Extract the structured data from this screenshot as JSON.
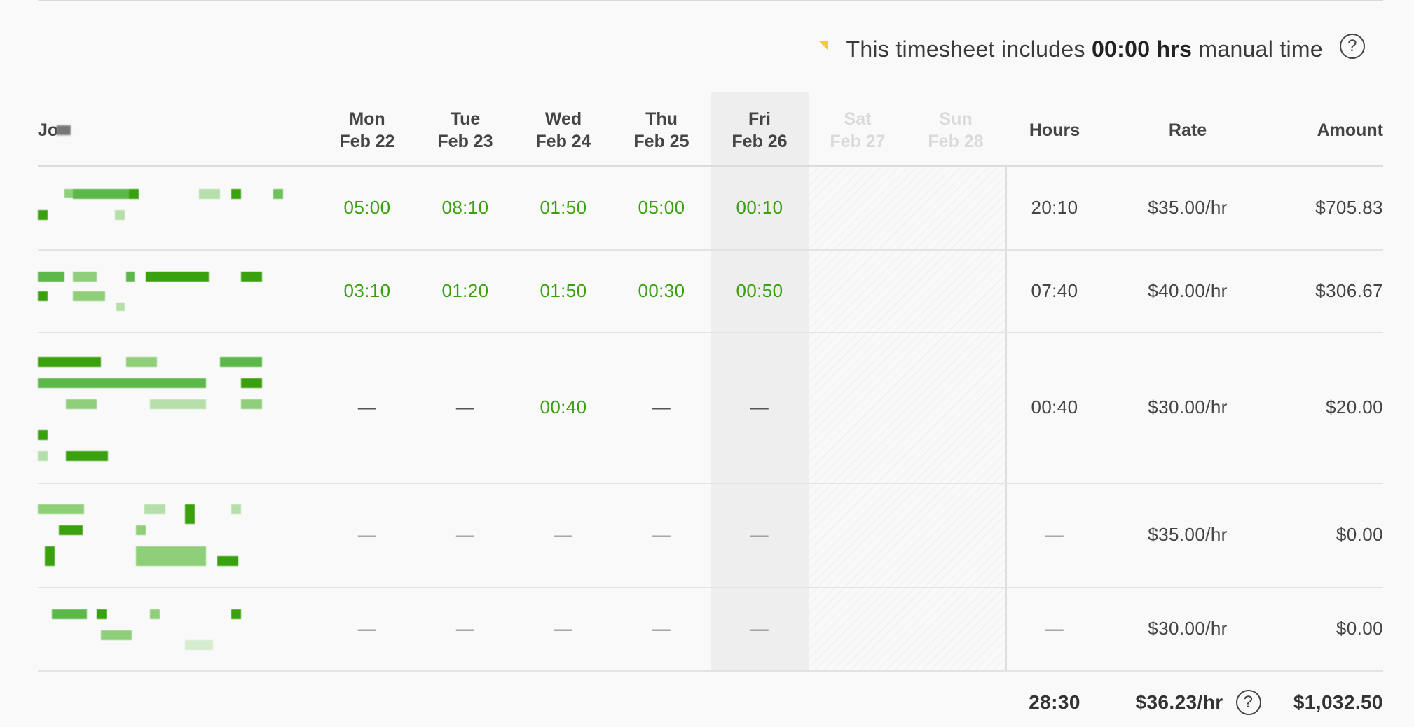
{
  "notice": {
    "prefix": "This timesheet includes",
    "hours": "00:00 hrs",
    "suffix": "manual time",
    "help_glyph": "?",
    "flag_color": "#f5c842"
  },
  "header": {
    "job": "Jo",
    "days": [
      {
        "dow": "Mon",
        "date": "Feb 22"
      },
      {
        "dow": "Tue",
        "date": "Feb 23"
      },
      {
        "dow": "Wed",
        "date": "Feb 24"
      },
      {
        "dow": "Thu",
        "date": "Feb 25"
      },
      {
        "dow": "Fri",
        "date": "Feb 26"
      },
      {
        "dow": "Sat",
        "date": "Feb 27"
      },
      {
        "dow": "Sun",
        "date": "Feb 28"
      }
    ],
    "hours": "Hours",
    "rate": "Rate",
    "amount": "Amount"
  },
  "rows": [
    {
      "days": [
        "05:00",
        "08:10",
        "01:50",
        "05:00",
        "00:10"
      ],
      "hours": "20:10",
      "rate": "$35.00/hr",
      "amount": "$705.83"
    },
    {
      "days": [
        "03:10",
        "01:20",
        "01:50",
        "00:30",
        "00:50"
      ],
      "hours": "07:40",
      "rate": "$40.00/hr",
      "amount": "$306.67"
    },
    {
      "days": [
        "—",
        "—",
        "00:40",
        "—",
        "—"
      ],
      "hours": "00:40",
      "rate": "$30.00/hr",
      "amount": "$20.00"
    },
    {
      "days": [
        "—",
        "—",
        "—",
        "—",
        "—"
      ],
      "hours": "—",
      "rate": "$35.00/hr",
      "amount": "$0.00"
    },
    {
      "days": [
        "—",
        "—",
        "—",
        "—",
        "—"
      ],
      "hours": "—",
      "rate": "$30.00/hr",
      "amount": "$0.00"
    }
  ],
  "totals": {
    "hours": "28:30",
    "rate": "$36.23/hr",
    "help_glyph": "?",
    "amount": "$1,032.50"
  },
  "colors": {
    "time_green": "#3aa10e",
    "text": "#333333",
    "weekend_header": "#dadada",
    "friday_band": "#eeeeee"
  }
}
